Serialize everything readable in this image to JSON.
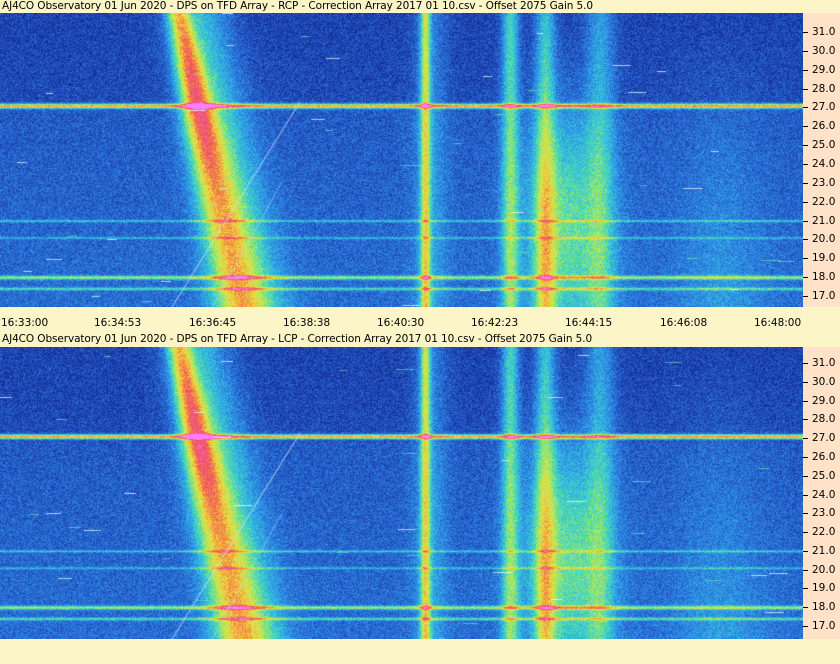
{
  "panels": [
    {
      "title": "AJ4CO Observatory 01 Jun 2020  -  DPS on TFD Array  -  RCP  -  Correction Array 2017 01 10.csv  -  Offset 2075  Gain 5.0",
      "polarization": "RCP"
    },
    {
      "title": "AJ4CO Observatory 01 Jun 2020  -  DPS on TFD Array  -  LCP  -  Correction Array 2017 01 10.csv  -  Offset 2075  Gain 5.0",
      "polarization": "LCP"
    }
  ],
  "freq_axis": {
    "labels": [
      "31.0",
      "30.0",
      "29.0",
      "28.0",
      "27.0",
      "26.0",
      "25.0",
      "24.0",
      "23.0",
      "22.0",
      "21.0",
      "20.0",
      "19.0",
      "18.0",
      "17.0"
    ],
    "values": [
      31,
      30,
      29,
      28,
      27,
      26,
      25,
      24,
      23,
      22,
      21,
      20,
      19,
      18,
      17
    ]
  },
  "time_axis": {
    "labels": [
      "16:33:00",
      "16:34:53",
      "16:36:45",
      "16:38:38",
      "16:40:30",
      "16:42:23",
      "16:44:15",
      "16:46:08",
      "16:48:00"
    ]
  },
  "colors": {
    "background": "#fcf5c8",
    "axis_panel": "#ffe2c8",
    "colormap": [
      "#0a1570",
      "#1a3aa8",
      "#2a6ed8",
      "#30a8e8",
      "#40d8c0",
      "#a8e860",
      "#f0e040",
      "#f08a40",
      "#f04070",
      "#ff80ff"
    ]
  }
}
